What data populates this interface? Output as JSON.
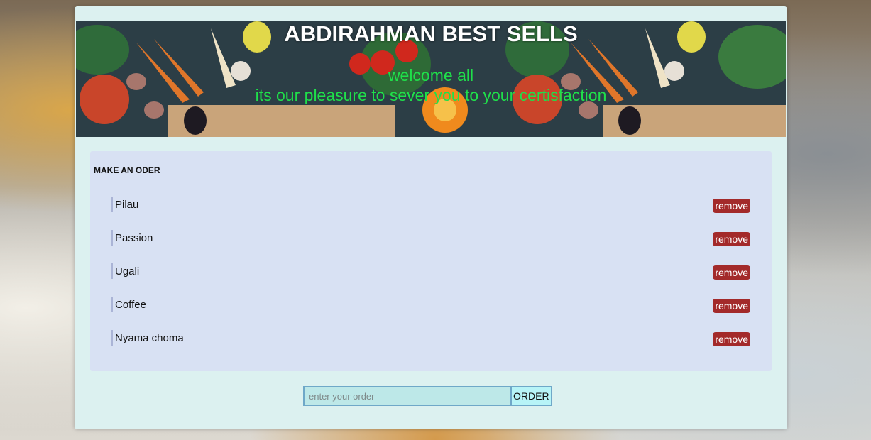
{
  "header": {
    "title": "ABDIRAHMAN BEST SELLS",
    "subtitle_line1": "welcome all",
    "subtitle_line2": "its our pleasure to sever you to your certisfaction"
  },
  "order_panel": {
    "title": "MAKE AN ODER",
    "items": [
      {
        "label": "Pilau",
        "action": "remove"
      },
      {
        "label": "Passion",
        "action": "remove"
      },
      {
        "label": "Ugali",
        "action": "remove"
      },
      {
        "label": "Coffee",
        "action": "remove"
      },
      {
        "label": "Nyama choma",
        "action": "remove"
      }
    ]
  },
  "order_form": {
    "input_value": "",
    "input_placeholder": "enter your order",
    "submit_label": "ORDER"
  },
  "colors": {
    "card_background": "#dcf1f0",
    "panel_background": "#d8e1f3",
    "remove_button": "#a32a2a",
    "subtitle_text": "#1fe04a",
    "order_button": "#b7f4f7"
  }
}
